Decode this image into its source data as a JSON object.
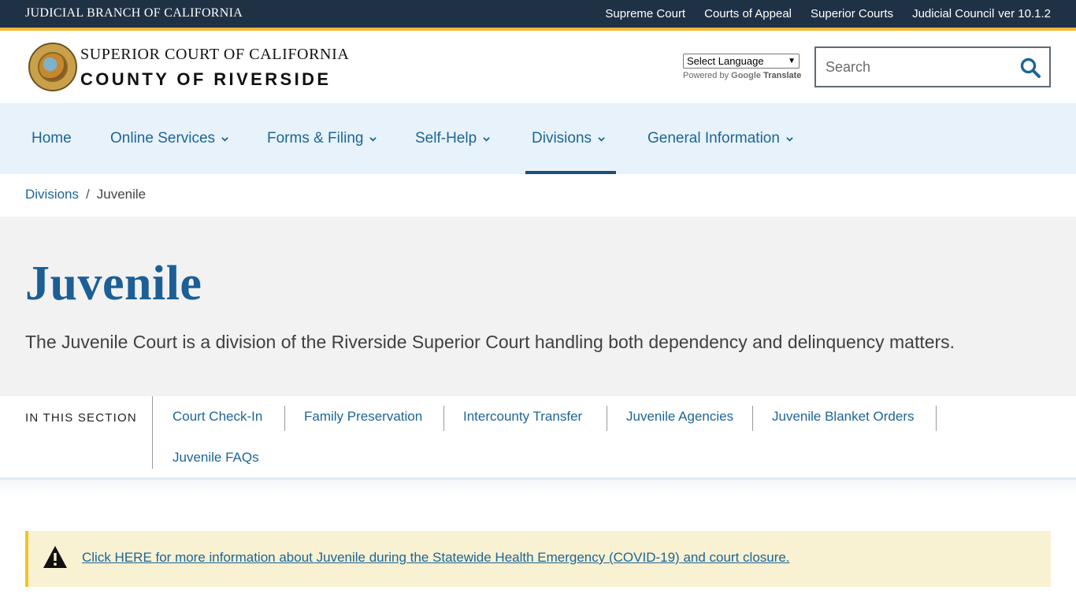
{
  "topbar": {
    "branch_title": "JUDICIAL BRANCH OF CALIFORNIA",
    "links": [
      "Supreme Court",
      "Courts of Appeal",
      "Superior Courts",
      "Judicial Council"
    ],
    "version": "ver 10.1.2"
  },
  "header": {
    "logo_line1": "SUPERIOR COURT OF CALIFORNIA",
    "logo_line2": "COUNTY OF RIVERSIDE",
    "language_select": "Select Language",
    "powered_by": "Powered by",
    "google": "Google",
    "translate": "Translate",
    "search_placeholder": "Search"
  },
  "nav": {
    "items": [
      "Home",
      "Online Services",
      "Forms & Filing",
      "Self-Help",
      "Divisions",
      "General Information"
    ],
    "active": "Divisions"
  },
  "breadcrumb": {
    "parent": "Divisions",
    "separator": "/",
    "current": "Juvenile"
  },
  "hero": {
    "title": "Juvenile",
    "description": "The Juvenile Court is a division of the Riverside Superior Court handling both dependency and delinquency matters."
  },
  "in_this_section": {
    "label": "IN THIS SECTION",
    "links": [
      "Court Check-In",
      "Family Preservation",
      "Intercounty Transfer",
      "Juvenile Agencies",
      "Juvenile Blanket Orders",
      "Juvenile FAQs"
    ]
  },
  "alert": {
    "text": "Click HERE for more information about Juvenile during the Statewide Health Emergency (COVID-19) and court closure."
  },
  "colors": {
    "topbar": "#1f3145",
    "gold": "#f0b739",
    "link_blue": "#1c6696",
    "title_blue": "#1c5e95",
    "nav_bg": "#e8f2fa",
    "hero_bg": "#f2f2f2",
    "alert_bg": "#f8f1d2"
  },
  "icons": {
    "search": "search-icon",
    "chevron": "chevron-down-icon",
    "alert": "warning-icon"
  }
}
